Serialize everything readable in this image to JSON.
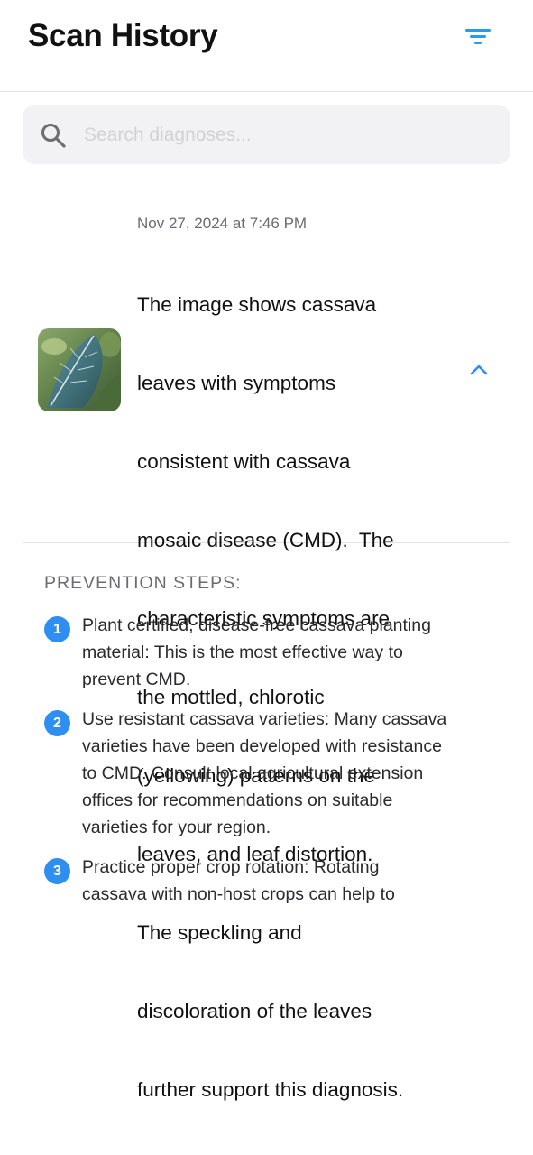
{
  "header": {
    "title": "Scan History",
    "filter_icon": "filter-lines-icon"
  },
  "search": {
    "placeholder": "Search diagnoses...",
    "icon": "search-icon"
  },
  "scan": {
    "date": "Nov 27, 2024 at 7:46 PM",
    "description_lines": [
      "The image shows cassava",
      "leaves with symptoms",
      "consistent with cassava",
      "mosaic disease (CMD).  The",
      "characteristic symptoms are",
      "the mottled, chlorotic",
      "(yellowing) patterns on the",
      "leaves, and leaf distortion.",
      "The speckling and",
      "discoloration of the leaves",
      "further support this diagnosis."
    ],
    "thumbnail_icon": "cassava-leaf-photo",
    "expand_icon": "chevron-up-icon"
  },
  "prevention": {
    "heading": "PREVENTION STEPS:",
    "steps": [
      {
        "number": "1",
        "lines": [
          "Plant certified, disease-free cassava planting",
          "material: This is the most effective way to",
          "prevent CMD."
        ]
      },
      {
        "number": "2",
        "lines": [
          "Use resistant cassava varieties: Many cassava",
          "varieties have been developed with resistance",
          "to CMD. Consult local agricultural extension",
          "offices for recommendations on suitable",
          "varieties for your region."
        ]
      },
      {
        "number": "3",
        "lines": [
          "Practice proper crop rotation: Rotating",
          "cassava with non-host crops can help to"
        ]
      }
    ]
  },
  "colors": {
    "accent": "#2f8ff0",
    "filter": "#2a9be6",
    "secondary_text": "#6b6b70"
  }
}
